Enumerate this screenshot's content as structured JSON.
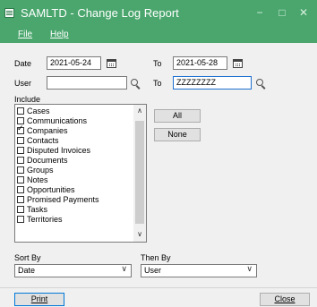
{
  "window": {
    "title": "SAMLTD - Change Log Report",
    "minimize": "−",
    "maximize": "□",
    "close": "✕"
  },
  "menu": {
    "file": "File",
    "help": "Help"
  },
  "filters": {
    "date_label": "Date",
    "date_from": "2021-05-24",
    "to_label": "To",
    "date_to": "2021-05-28",
    "user_label": "User",
    "user_from": "",
    "user_to_label": "To",
    "user_to": "ZZZZZZZZ"
  },
  "include": {
    "label": "Include",
    "items": [
      {
        "label": "Cases",
        "checked": false
      },
      {
        "label": "Communications",
        "checked": false
      },
      {
        "label": "Companies",
        "checked": true
      },
      {
        "label": "Contacts",
        "checked": false
      },
      {
        "label": "Disputed Invoices",
        "checked": false
      },
      {
        "label": "Documents",
        "checked": false
      },
      {
        "label": "Groups",
        "checked": false
      },
      {
        "label": "Notes",
        "checked": false
      },
      {
        "label": "Opportunities",
        "checked": false
      },
      {
        "label": "Promised Payments",
        "checked": false
      },
      {
        "label": "Tasks",
        "checked": false
      },
      {
        "label": "Territories",
        "checked": false
      }
    ],
    "all_button": "All",
    "none_button": "None"
  },
  "sort": {
    "sort_by_label": "Sort By",
    "sort_by_value": "Date",
    "then_by_label": "Then By",
    "then_by_value": "User"
  },
  "footer": {
    "print_button": "Print",
    "close_button": "Close"
  }
}
